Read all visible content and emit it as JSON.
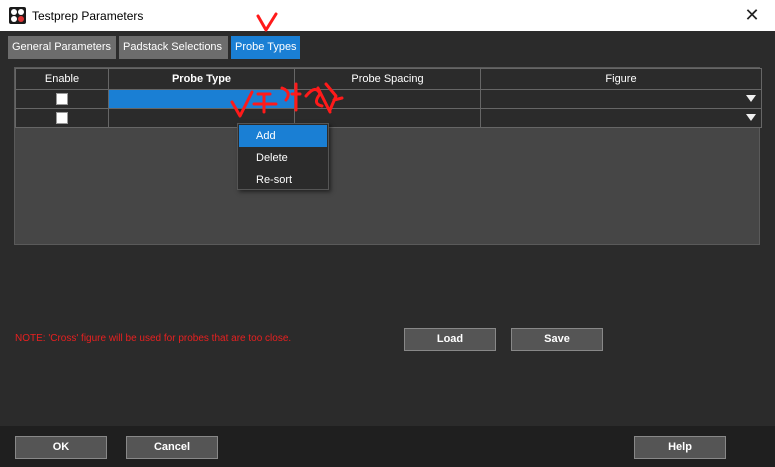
{
  "window": {
    "title": "Testprep Parameters",
    "app_icon": "testprep-app-icon",
    "close_glyph": "✕"
  },
  "tabs": [
    {
      "label": "General Parameters",
      "active": false
    },
    {
      "label": "Padstack Selections",
      "active": false
    },
    {
      "label": "Probe Types",
      "active": true
    }
  ],
  "grid": {
    "columns": [
      "Enable",
      "Probe Type",
      "Probe Spacing",
      "Figure"
    ],
    "rows": [
      {
        "enable": false,
        "probe_type": "",
        "probe_spacing": "",
        "figure": "",
        "selected": true
      },
      {
        "enable": false,
        "probe_type": "",
        "probe_spacing": "",
        "figure": "",
        "selected": false
      }
    ]
  },
  "context_menu": {
    "items": [
      "Add",
      "Delete",
      "Re-sort"
    ],
    "highlighted": "Add"
  },
  "note": "NOTE: 'Cross' figure will be used for probes that are too close.",
  "buttons": {
    "load": "Load",
    "save": "Save",
    "ok": "OK",
    "cancel": "Cancel",
    "help": "Help"
  },
  "colors": {
    "accent": "#1a7fd4",
    "background": "#2b2b2b",
    "note": "#e82020",
    "annotation": "#ff1a1a"
  }
}
